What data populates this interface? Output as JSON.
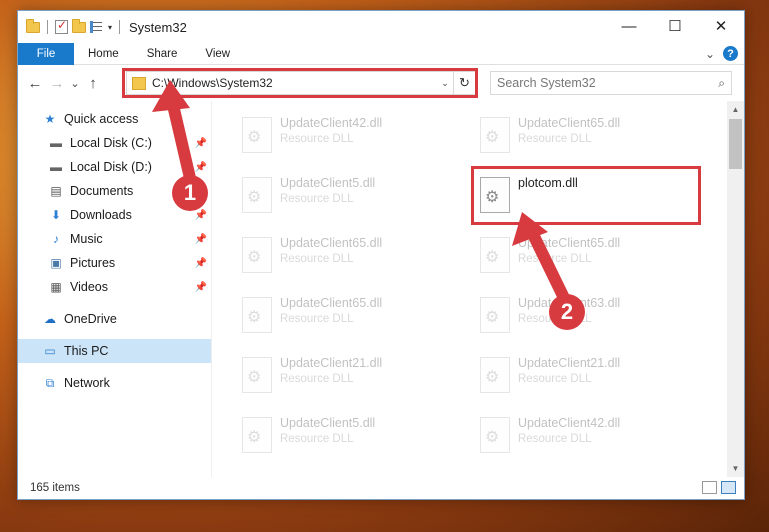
{
  "window": {
    "title": "System32",
    "controls": {
      "minimize": "—",
      "maximize": "☐",
      "close": "✕"
    }
  },
  "ribbon": {
    "tabs": [
      "File",
      "Home",
      "Share",
      "View"
    ],
    "expand_label": "⌄",
    "help_label": "?"
  },
  "nav": {
    "back": "←",
    "forward": "→",
    "recent": "⌄",
    "up": "↑"
  },
  "address": {
    "path": "C:\\Windows\\System32",
    "dropdown": "⌄",
    "refresh": "↻"
  },
  "search": {
    "placeholder": "Search System32",
    "icon": "⌕"
  },
  "sidebar": {
    "items": [
      {
        "label": "Quick access",
        "icon": "★",
        "icon_name": "star-icon",
        "pinned": false
      },
      {
        "label": "Local Disk (C:)",
        "icon": "▬",
        "icon_name": "drive-icon",
        "pinned": true
      },
      {
        "label": "Local Disk (D:)",
        "icon": "▬",
        "icon_name": "drive-icon",
        "pinned": true
      },
      {
        "label": "Documents",
        "icon": "▤",
        "icon_name": "documents-icon",
        "pinned": true
      },
      {
        "label": "Downloads",
        "icon": "⬇",
        "icon_name": "download-icon",
        "pinned": true
      },
      {
        "label": "Music",
        "icon": "♪",
        "icon_name": "music-icon",
        "pinned": true
      },
      {
        "label": "Pictures",
        "icon": "▣",
        "icon_name": "pictures-icon",
        "pinned": true
      },
      {
        "label": "Videos",
        "icon": "▦",
        "icon_name": "videos-icon",
        "pinned": true
      },
      {
        "label": "OneDrive",
        "icon": "☁",
        "icon_name": "cloud-icon",
        "pinned": false
      },
      {
        "label": "This PC",
        "icon": "▭",
        "icon_name": "computer-icon",
        "pinned": false
      },
      {
        "label": "Network",
        "icon": "⧉",
        "icon_name": "network-icon",
        "pinned": false
      }
    ],
    "pin_glyph": "📌"
  },
  "files": [
    {
      "name": "UpdateClient42.dll",
      "type": "Resource DLL"
    },
    {
      "name": "UpdateClient65.dll",
      "type": "Resource DLL"
    },
    {
      "name": "UpdateClient5.dll",
      "type": "Resource DLL"
    },
    {
      "name": "plotcom.dll",
      "type": ""
    },
    {
      "name": "UpdateClient65.dll",
      "type": "Resource DLL"
    },
    {
      "name": "UpdateClient65.dll",
      "type": "Resource DLL"
    },
    {
      "name": "UpdateClient65.dll",
      "type": "Resource DLL"
    },
    {
      "name": "UpdateClient63.dll",
      "type": "Resource DLL"
    },
    {
      "name": "UpdateClient21.dll",
      "type": "Resource DLL"
    },
    {
      "name": "UpdateClient21.dll",
      "type": "Resource DLL"
    },
    {
      "name": "UpdateClient5.dll",
      "type": "Resource DLL"
    },
    {
      "name": "UpdateClient42.dll",
      "type": "Resource DLL"
    }
  ],
  "status": {
    "item_count": "165 items"
  },
  "annotations": {
    "badge1": "1",
    "badge2": "2",
    "color": "#d73b3f"
  },
  "accent_color": "#1979ca"
}
